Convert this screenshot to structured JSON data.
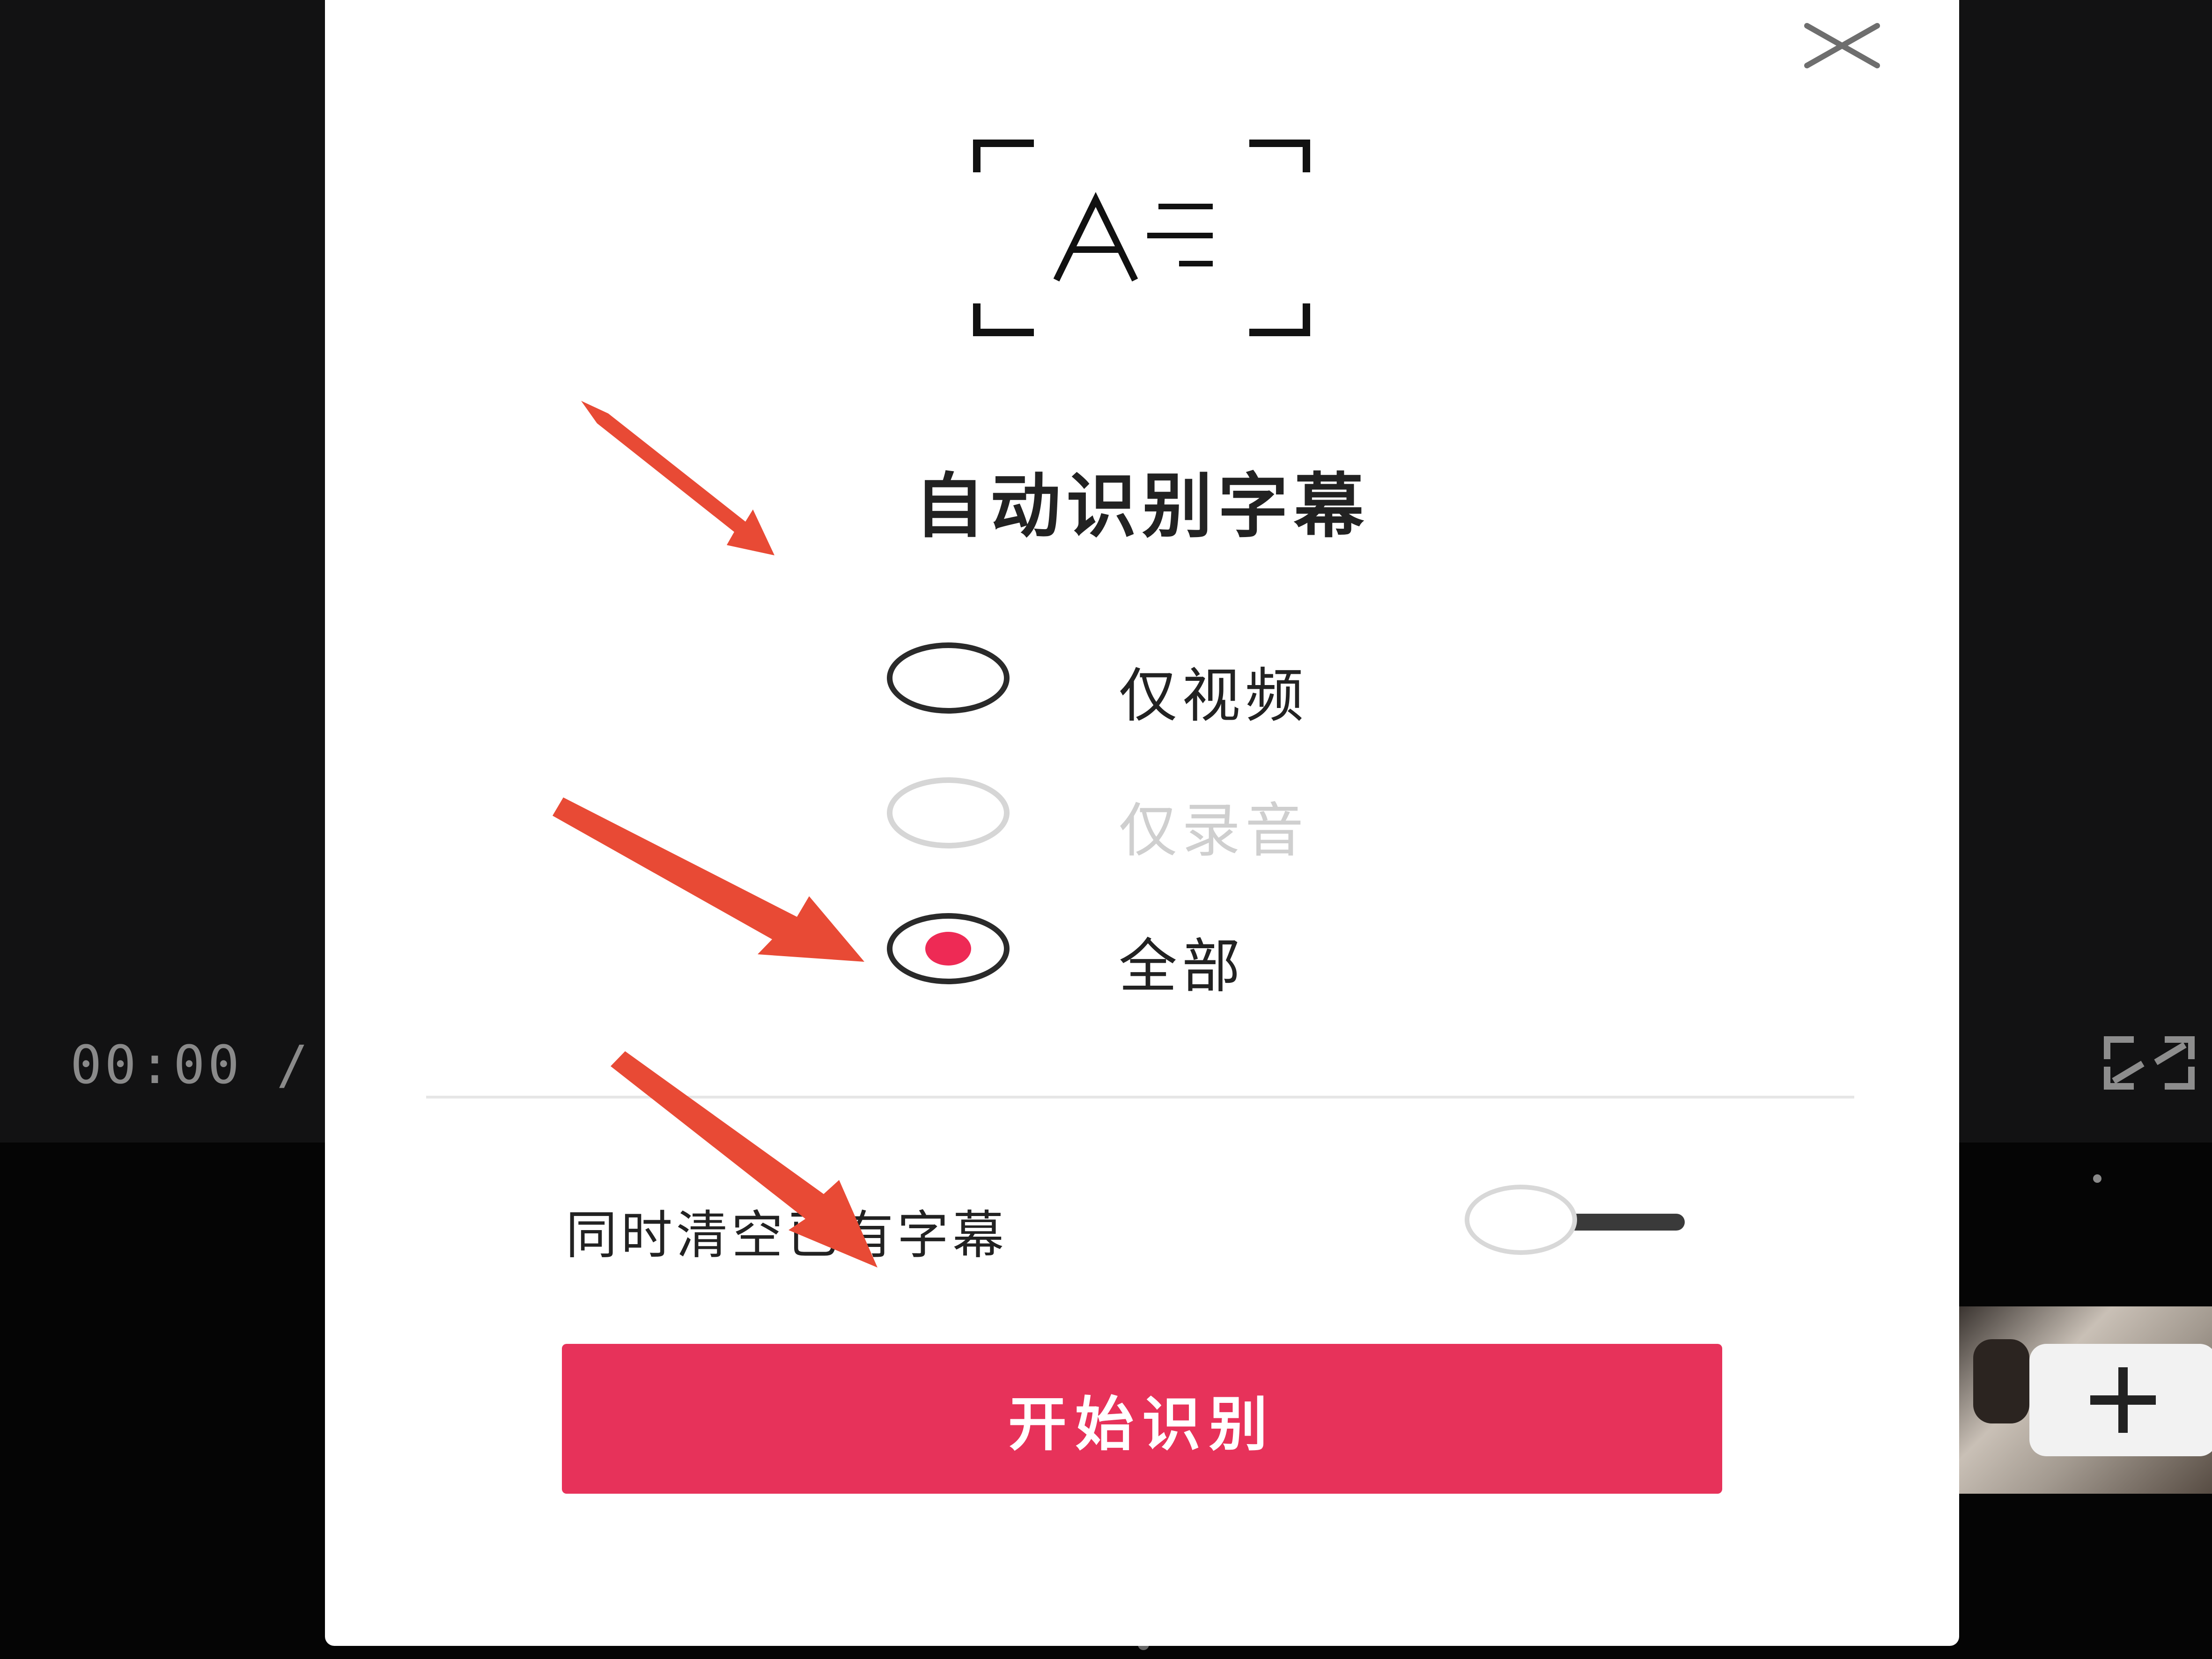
{
  "player": {
    "timecode": "00:00 /"
  },
  "dialog": {
    "title": "自动识别字幕",
    "options": [
      {
        "label": "仅视频",
        "selected": false,
        "disabled": false
      },
      {
        "label": "仅录音",
        "selected": false,
        "disabled": true
      },
      {
        "label": "全部",
        "selected": true,
        "disabled": false
      }
    ],
    "clear_existing": {
      "label": "同时清空已有字幕",
      "enabled": false
    },
    "start_button_label": "开始识别"
  },
  "icons": [
    "close-icon",
    "subtitle-recognition-icon",
    "fullscreen-icon",
    "plus-icon"
  ],
  "colors": {
    "accent": "#e7325a",
    "radio_selected_dot": "#ee2a55",
    "annotation_arrow": "#e84a35",
    "dialog_background": "#ffffff",
    "app_background": "#121213"
  }
}
